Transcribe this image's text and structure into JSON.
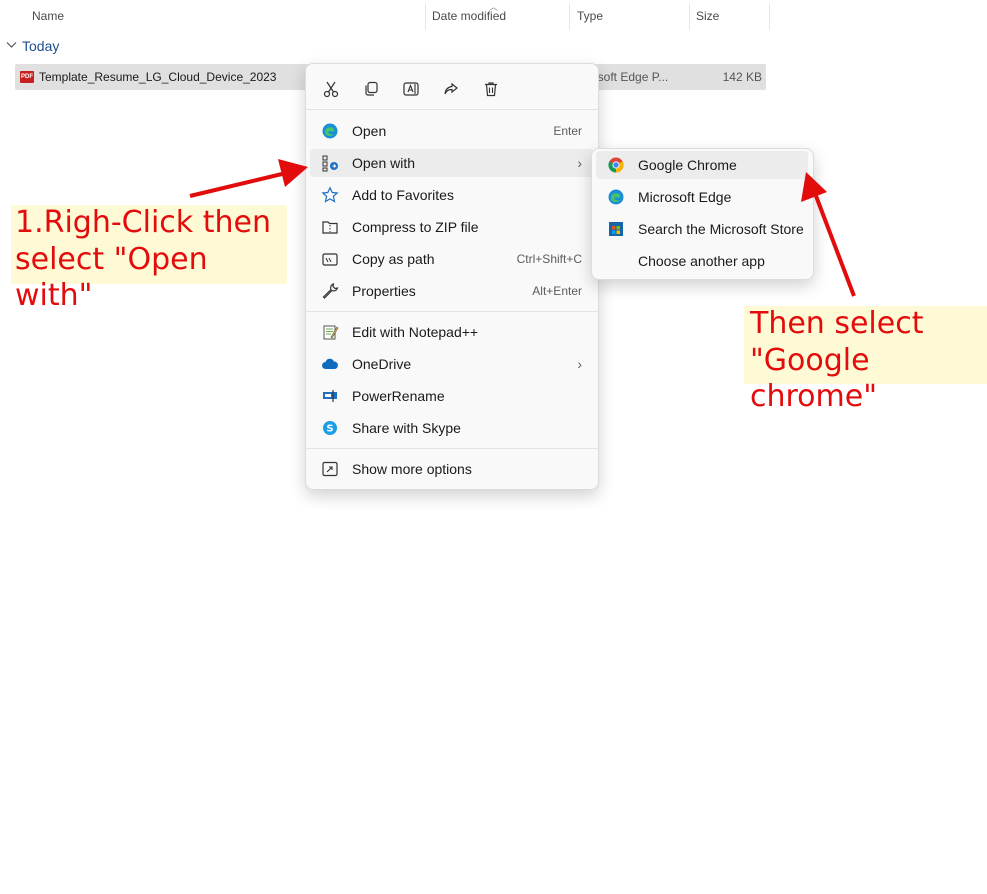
{
  "columns": {
    "name": "Name",
    "date_modified": "Date modified",
    "type": "Type",
    "size": "Size"
  },
  "group": {
    "label": "Today"
  },
  "file": {
    "icon_text": "PDF",
    "name": "Template_Resume_LG_Cloud_Device_2023",
    "type": "rosoft Edge P...",
    "size": "142 KB"
  },
  "context_menu": {
    "quick_actions": [
      "cut-icon",
      "copy-icon",
      "rename-icon",
      "share-icon",
      "delete-icon"
    ],
    "items": [
      {
        "label": "Open",
        "shortcut": "Enter",
        "icon": "edge-icon"
      },
      {
        "label": "Open with",
        "shortcut": "",
        "icon": "open-with-icon",
        "has_submenu": true
      },
      {
        "label": "Add to Favorites",
        "shortcut": "",
        "icon": "star-icon"
      },
      {
        "label": "Compress to ZIP file",
        "shortcut": "",
        "icon": "zip-icon"
      },
      {
        "label": "Copy as path",
        "shortcut": "Ctrl+Shift+C",
        "icon": "copy-path-icon"
      },
      {
        "label": "Properties",
        "shortcut": "Alt+Enter",
        "icon": "wrench-icon"
      },
      {
        "label": "Edit with Notepad++",
        "shortcut": "",
        "icon": "notepad-icon"
      },
      {
        "label": "OneDrive",
        "shortcut": "",
        "icon": "cloud-icon",
        "has_submenu": true
      },
      {
        "label": "PowerRename",
        "shortcut": "",
        "icon": "powerrename-icon"
      },
      {
        "label": "Share with Skype",
        "shortcut": "",
        "icon": "skype-icon"
      },
      {
        "label": "Show more options",
        "shortcut": "",
        "icon": "more-options-icon"
      }
    ]
  },
  "submenu": {
    "items": [
      {
        "label": "Google Chrome",
        "icon": "chrome-icon"
      },
      {
        "label": "Microsoft Edge",
        "icon": "edge-icon"
      },
      {
        "label": "Search the Microsoft Store",
        "icon": "store-icon"
      },
      {
        "label": "Choose another app",
        "icon": ""
      }
    ]
  },
  "annotations": {
    "note1_line1": "1.Righ-Click then",
    "note1_line2": "select \"Open with\"",
    "note2_line1": "Then select",
    "note2_line2": "\"Google chrome\""
  },
  "colors": {
    "annotation_text": "#e20c0c",
    "annotation_bg": "#fffad6",
    "selection": "#e0e0e0",
    "group_label": "#1f4e8c"
  }
}
